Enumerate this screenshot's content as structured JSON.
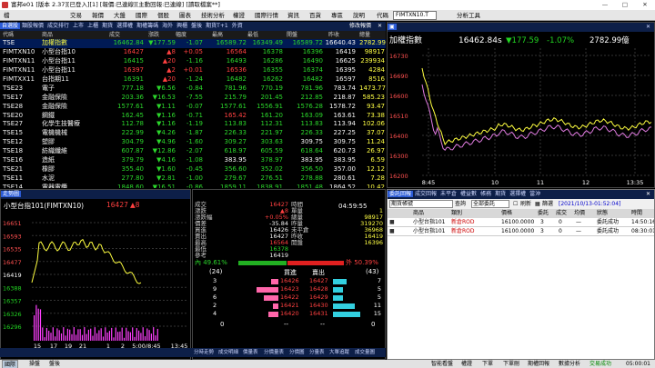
{
  "title": "富邦e01 [版本 2.37][已登入][1] [報價:已連線][主動回報:已連線] [讀取檔案**]",
  "menu": [
    "檔",
    "交易",
    "報價",
    "大盤",
    "國際",
    "個股",
    "圖表",
    "技術分析",
    "權證",
    "國際行情",
    "資訊",
    "百貨",
    "專區",
    "說明",
    "代碼",
    "分析工具"
  ],
  "symbol_combo": "FIMTXN10.T",
  "quote": {
    "tabs": [
      "自選股",
      "類股報價",
      "成交排行",
      "上市",
      "上櫃",
      "期貨",
      "選擇權",
      "期權籌碼",
      "海外",
      "興櫃",
      "盤後",
      "期貨T+1",
      "外資"
    ],
    "user_label": "修改報價",
    "headers": [
      "代碼",
      "商品",
      "成交",
      "漲跌",
      "幅度",
      "最高",
      "最低",
      "開盤",
      "昨收",
      "總量"
    ],
    "rows": [
      [
        "TSE",
        "加權指數",
        "16462.84",
        "▼177.59",
        "-1.07",
        "16589.72",
        "16349.49",
        "16589.72",
        "16640.43",
        "2782.99"
      ],
      [
        "FIMTXN10",
        "小型台指10",
        "16427",
        "▲8",
        "+0.05",
        "16564",
        "16378",
        "16396",
        "16419",
        "98917"
      ],
      [
        "FIMTXN11",
        "小型台指11",
        "16415",
        "▲20",
        "-1.16",
        "16493",
        "16286",
        "16490",
        "16625",
        "239934"
      ],
      [
        "FIMTXN11",
        "小型台指11",
        "16397",
        "▲2",
        "+0.01",
        "16536",
        "16355",
        "16374",
        "16395",
        "4284"
      ],
      [
        "FIMTXX11",
        "台指期11",
        "16391",
        "▲20",
        "-1.24",
        "16482",
        "16262",
        "16482",
        "16597",
        "8516"
      ],
      [
        "TSE23",
        "電子",
        "777.18",
        "▼6.56",
        "-0.84",
        "781.96",
        "770.19",
        "781.96",
        "783.74",
        "1473.77"
      ],
      [
        "TSE17",
        "金融保險",
        "203.36",
        "▼16.53",
        "-7.55",
        "215.79",
        "201.45",
        "212.85",
        "218.87",
        "585.23"
      ],
      [
        "TSE28",
        "金融保險",
        "1577.61",
        "▼1.11",
        "-0.07",
        "1577.61",
        "1556.91",
        "1576.28",
        "1578.72",
        "93.47"
      ],
      [
        "TSE20",
        "鋼鐵",
        "162.45",
        "▼1.16",
        "-0.71",
        "165.42",
        "161.20",
        "163.09",
        "163.61",
        "73.38"
      ],
      [
        "TSE27",
        "化學生技醫療",
        "112.78",
        "▼1.16",
        "-1.19",
        "113.83",
        "112.31",
        "113.83",
        "113.94",
        "102.06"
      ],
      [
        "TSE15",
        "電機機械",
        "222.99",
        "▼4.26",
        "-1.87",
        "226.33",
        "221.97",
        "226.33",
        "227.25",
        "37.07"
      ],
      [
        "TSE12",
        "塑膠",
        "304.79",
        "▼4.96",
        "-1.60",
        "309.27",
        "303.63",
        "309.75",
        "309.75",
        "11.24"
      ],
      [
        "TSE18",
        "紡織纖維",
        "607.87",
        "▼12.86",
        "-2.07",
        "618.97",
        "605.59",
        "618.64",
        "620.73",
        "26.97"
      ],
      [
        "TSE16",
        "造紙",
        "379.79",
        "▼4.16",
        "-1.08",
        "383.95",
        "378.97",
        "383.95",
        "383.95",
        "6.59"
      ],
      [
        "TSE21",
        "橡膠",
        "355.40",
        "▼1.60",
        "-0.45",
        "356.60",
        "352.02",
        "356.50",
        "357.00",
        "12.12"
      ],
      [
        "TSE11",
        "水泥",
        "277.80",
        "▼2.81",
        "-1.00",
        "279.67",
        "276.51",
        "278.88",
        "280.61",
        "7.28"
      ],
      [
        "TSE14",
        "電器電纜",
        "1848.60",
        "▼16.51",
        "-0.86",
        "1859.11",
        "1838.91",
        "1851.48",
        "1864.52",
        "10.42"
      ],
      [
        "TSE22",
        "汽車",
        "318.09",
        "▼1.35",
        "-0.42",
        "319.30",
        "312.46",
        "319.30",
        "319.44",
        "16.57"
      ]
    ]
  },
  "index_chart": {
    "title": "加權指數",
    "last": "16462.84s",
    "change": "▼177.59",
    "pct": "-1.07%",
    "volume": "2782.99億",
    "y_ticks": [
      "16730",
      "16690",
      "16600",
      "16510",
      "16400",
      "16300",
      "16200"
    ],
    "x_ticks": [
      "8:45",
      "10",
      "11",
      "12",
      "13:35"
    ]
  },
  "minute_chart": {
    "tab": "走勢圖",
    "name": "小型台指101(FIMTXN10)",
    "price": "16427",
    "change": "▲8",
    "y_ticks": [
      "16651",
      "16593",
      "16535",
      "16477",
      "16419",
      "16388",
      "16357",
      "16326",
      "16296"
    ],
    "x_ticks": [
      "15",
      "17",
      "19",
      "21",
      "1",
      "2",
      "5:00/8:45",
      "13:45"
    ],
    "bottom_tabs": [
      "分時走勢",
      "成交明細",
      "價量表",
      "分價量表",
      "分價圖",
      "分量表",
      "大單追蹤",
      "成交量圖"
    ]
  },
  "detail": {
    "time": "04:59:55",
    "left": [
      [
        "成交",
        "16427"
      ],
      [
        "漲跌",
        "▲8"
      ],
      [
        "漲跌幅",
        "+0.05%"
      ],
      [
        "價差",
        "-35.84"
      ],
      [
        "買進",
        "16426"
      ],
      [
        "賣出",
        "16427"
      ],
      [
        "最高",
        "16564"
      ],
      [
        "最低",
        "16378"
      ],
      [
        "參考",
        "16419"
      ]
    ],
    "right": [
      [
        "時間",
        ""
      ],
      [
        "單量",
        "1"
      ],
      [
        "總量",
        "98917"
      ],
      [
        "昨量",
        "319270"
      ],
      [
        "未平倉",
        "36968"
      ],
      [
        "昨收",
        "16419"
      ],
      [
        "開盤",
        "16396"
      ]
    ],
    "inner_pct": "內 49.61%",
    "outer_pct": "外 50.39%",
    "bid_total": "(24)",
    "ask_total": "(43)",
    "col_buy": "買進",
    "col_sell": "賣出",
    "book": [
      {
        "bq": "3",
        "bp": "16426",
        "ap": "16427",
        "aq": "7",
        "bf": 0.2,
        "af": 0.5
      },
      {
        "bq": "9",
        "bp": "16423",
        "ap": "16428",
        "aq": "5",
        "bf": 0.6,
        "af": 0.35
      },
      {
        "bq": "6",
        "bp": "16422",
        "ap": "16429",
        "aq": "5",
        "bf": 0.4,
        "af": 0.35
      },
      {
        "bq": "2",
        "bp": "16421",
        "ap": "16430",
        "aq": "11",
        "bf": 0.15,
        "af": 0.8
      },
      {
        "bq": "4",
        "bp": "16420",
        "ap": "16431",
        "aq": "15",
        "bf": 0.28,
        "af": 1.0
      }
    ]
  },
  "orders": {
    "tabs": [
      "委託回報",
      "成交回報",
      "未平倉",
      "權益數",
      "帳務",
      "期貨",
      "選擇權",
      "當沖"
    ],
    "account_label": "期貨帳號",
    "query_btn": "查詢",
    "scope": "全部委託",
    "refresh_btn": "刷新",
    "filter_btn": "篩選",
    "datetime": "[2021/10/13-01:52:04]",
    "headers": [
      "",
      "商品",
      "類別",
      "價格",
      "委託",
      "成交",
      "均價",
      "狀態",
      "時間"
    ],
    "rows": [
      [
        "",
        "小型台指101",
        "新倉ROD",
        "16100.0000",
        "3",
        "0",
        "—",
        "委託成功",
        "14:50:16"
      ],
      [
        "",
        "小型台指101",
        "新倉ROD",
        "16100.0000",
        "3",
        "0",
        "—",
        "委託成功",
        "08:30:01"
      ]
    ]
  },
  "bottom": {
    "left": [
      "國際",
      "操盤",
      "盤後"
    ],
    "right": [
      "智能看盤",
      "權證",
      "下單",
      "下單刪",
      "期權回報",
      "數據分析",
      "交易成功",
      "05:00:01"
    ]
  }
}
